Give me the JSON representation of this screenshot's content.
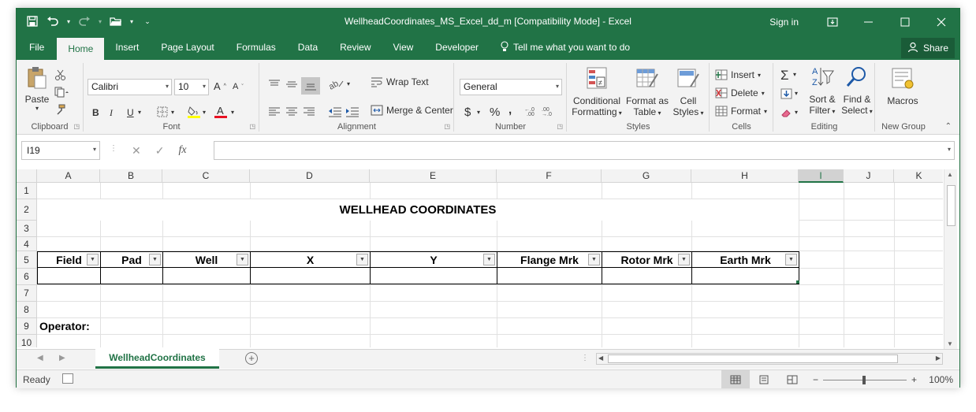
{
  "titlebar": {
    "title": "WellheadCoordinates_MS_Excel_dd_m  [Compatibility Mode] - Excel",
    "sign_in": "Sign in"
  },
  "tabs": [
    "File",
    "Home",
    "Insert",
    "Page Layout",
    "Formulas",
    "Data",
    "Review",
    "View",
    "Developer"
  ],
  "tell_me": "Tell me what you want to do",
  "share": "Share",
  "ribbon": {
    "clipboard": {
      "label": "Clipboard",
      "paste": "Paste"
    },
    "font": {
      "label": "Font",
      "name": "Calibri",
      "size": "10",
      "bold": "B",
      "italic": "I",
      "underline": "U"
    },
    "alignment": {
      "label": "Alignment",
      "wrap": "Wrap Text",
      "merge": "Merge & Center"
    },
    "number": {
      "label": "Number",
      "format": "General",
      "currency": "$",
      "percent": "%",
      "comma": ","
    },
    "styles": {
      "label": "Styles",
      "cond1": "Conditional",
      "cond2": "Formatting",
      "table1": "Format as",
      "table2": "Table",
      "cell1": "Cell",
      "cell2": "Styles"
    },
    "cells": {
      "label": "Cells",
      "insert": "Insert",
      "delete": "Delete",
      "format": "Format"
    },
    "editing": {
      "label": "Editing",
      "sort1": "Sort &",
      "sort2": "Filter",
      "find1": "Find &",
      "find2": "Select"
    },
    "newgroup": {
      "label": "New Group",
      "macros": "Macros"
    }
  },
  "formula_bar": {
    "name_box": "I19",
    "fx": "fx",
    "value": ""
  },
  "columns": [
    "A",
    "B",
    "C",
    "D",
    "E",
    "F",
    "G",
    "H",
    "I",
    "J",
    "K"
  ],
  "selected_column": "I",
  "rows": [
    "1",
    "2",
    "3",
    "4",
    "5",
    "6",
    "7",
    "8",
    "9",
    "10"
  ],
  "sheet": {
    "title": "WELLHEAD COORDINATES",
    "headers": [
      "Field",
      "Pad",
      "Well",
      "X",
      "Y",
      "Flange Mrk",
      "Rotor Mrk",
      "Earth Mrk"
    ],
    "operator_label": "Operator:"
  },
  "sheet_tabs": {
    "active": "WellheadCoordinates"
  },
  "status": {
    "ready": "Ready",
    "zoom": "100%"
  }
}
